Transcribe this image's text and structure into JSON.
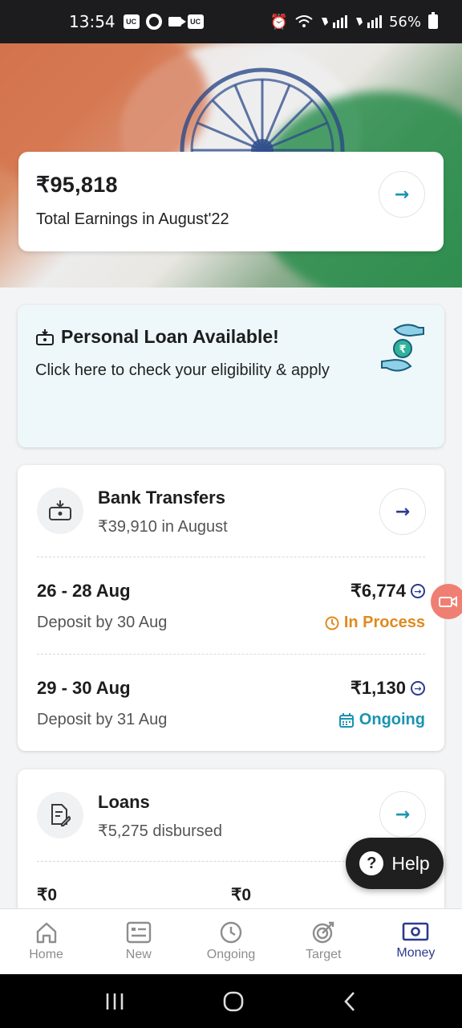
{
  "status_bar": {
    "time": "13:54",
    "uc_label": "UC",
    "battery": "56%"
  },
  "earnings": {
    "amount": "₹95,818",
    "label": "Total Earnings in August'22"
  },
  "loan_banner": {
    "title": "Personal Loan Available!",
    "subtitle": "Click here to check your eligibility & apply"
  },
  "bank_transfers": {
    "title": "Bank Transfers",
    "subtitle": "₹39,910 in August",
    "rows": [
      {
        "date": "26 - 28 Aug",
        "deposit": "Deposit by 30 Aug",
        "amount": "₹6,774",
        "status": "In Process",
        "status_color": "#e08a1e"
      },
      {
        "date": "29 - 30 Aug",
        "deposit": "Deposit by 31 Aug",
        "amount": "₹1,130",
        "status": "Ongoing",
        "status_color": "#1a93b0"
      }
    ]
  },
  "loans": {
    "title": "Loans",
    "subtitle": "₹5,275 disbursed",
    "values": [
      "₹0",
      "₹0"
    ]
  },
  "help_button": {
    "label": "Help"
  },
  "bottom_nav": [
    {
      "label": "Home",
      "icon": "home-icon"
    },
    {
      "label": "New",
      "icon": "card-list-icon"
    },
    {
      "label": "Ongoing",
      "icon": "clock-icon"
    },
    {
      "label": "Target",
      "icon": "target-icon"
    },
    {
      "label": "Money",
      "icon": "money-icon",
      "active": true
    }
  ],
  "colors": {
    "accent": "#2b3a8f",
    "teal": "#1a93b0",
    "orange": "#e08a1e"
  }
}
